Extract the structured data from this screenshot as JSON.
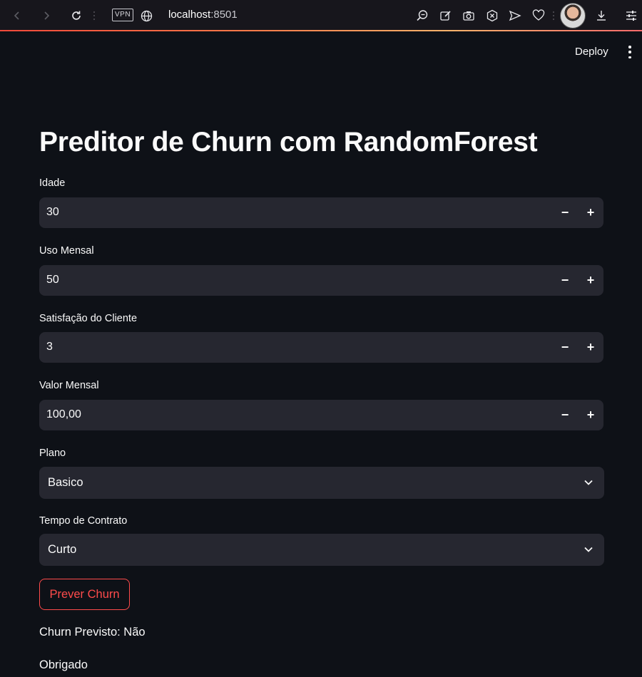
{
  "browser": {
    "vpn_label": "VPN",
    "url_host": "localhost",
    "url_port": ":8501"
  },
  "header": {
    "deploy_label": "Deploy"
  },
  "main": {
    "title": "Preditor de Churn com RandomForest",
    "fields": [
      {
        "label": "Idade",
        "value": "30"
      },
      {
        "label": "Uso Mensal",
        "value": "50"
      },
      {
        "label": "Satisfação do Cliente",
        "value": "3"
      },
      {
        "label": "Valor Mensal",
        "value": "100,00"
      }
    ],
    "selects": [
      {
        "label": "Plano",
        "value": "Basico"
      },
      {
        "label": "Tempo de Contrato",
        "value": "Curto"
      }
    ],
    "stepper": {
      "minus": "−",
      "plus": "+"
    },
    "button_label": "Prever Churn",
    "result": "Churn Previsto: Não",
    "thanks": "Obrigado"
  },
  "colors": {
    "background": "#0e1117",
    "input_bg": "#262730",
    "accent": "#ff4b4b"
  }
}
